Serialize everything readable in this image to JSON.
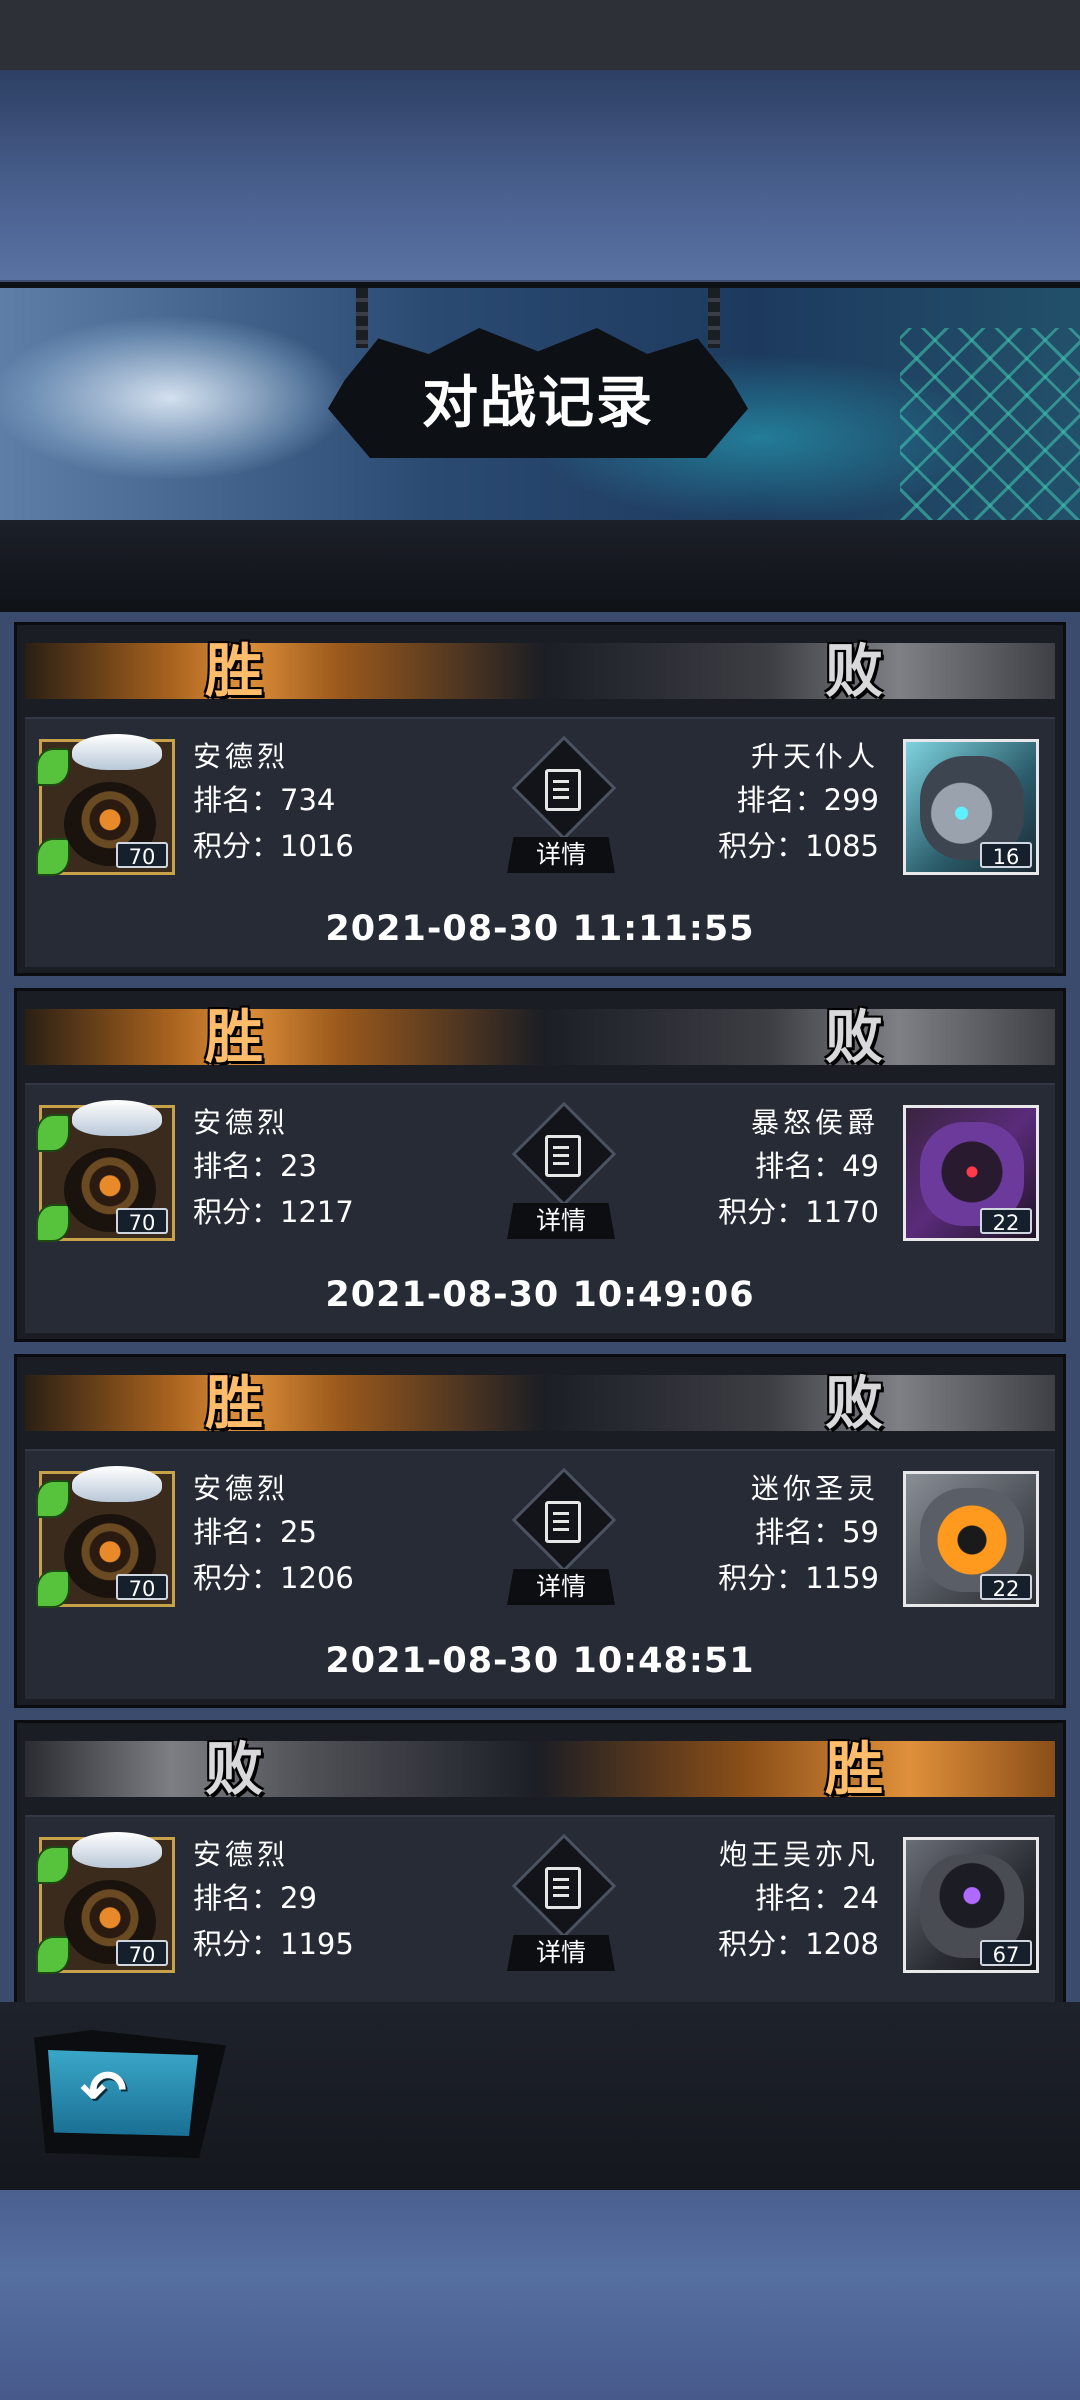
{
  "title": "对战记录",
  "details_label": "详情",
  "labels": {
    "rank": "排名：",
    "score": "积分："
  },
  "back_icon": "back-arrow-icon",
  "colors": {
    "win": "#ffbc6a",
    "lose": "#d9d9db",
    "accent_blue": "#3aa7c8"
  },
  "records": [
    {
      "left_result": "胜",
      "right_result": "败",
      "player": {
        "name": "安德烈",
        "rank": "734",
        "score": "1016",
        "level": "70"
      },
      "opponent": {
        "name": "升天仆人",
        "rank": "299",
        "score": "1085",
        "level": "16"
      },
      "time": "2021-08-30 11:11:55"
    },
    {
      "left_result": "胜",
      "right_result": "败",
      "player": {
        "name": "安德烈",
        "rank": "23",
        "score": "1217",
        "level": "70"
      },
      "opponent": {
        "name": "暴怒侯爵",
        "rank": "49",
        "score": "1170",
        "level": "22"
      },
      "time": "2021-08-30 10:49:06"
    },
    {
      "left_result": "胜",
      "right_result": "败",
      "player": {
        "name": "安德烈",
        "rank": "25",
        "score": "1206",
        "level": "70"
      },
      "opponent": {
        "name": "迷你圣灵",
        "rank": "59",
        "score": "1159",
        "level": "22"
      },
      "time": "2021-08-30 10:48:51"
    },
    {
      "left_result": "败",
      "right_result": "胜",
      "player": {
        "name": "安德烈",
        "rank": "29",
        "score": "1195",
        "level": "70"
      },
      "opponent": {
        "name": "炮王吴亦凡",
        "rank": "24",
        "score": "1208",
        "level": "67"
      },
      "time": ""
    }
  ]
}
